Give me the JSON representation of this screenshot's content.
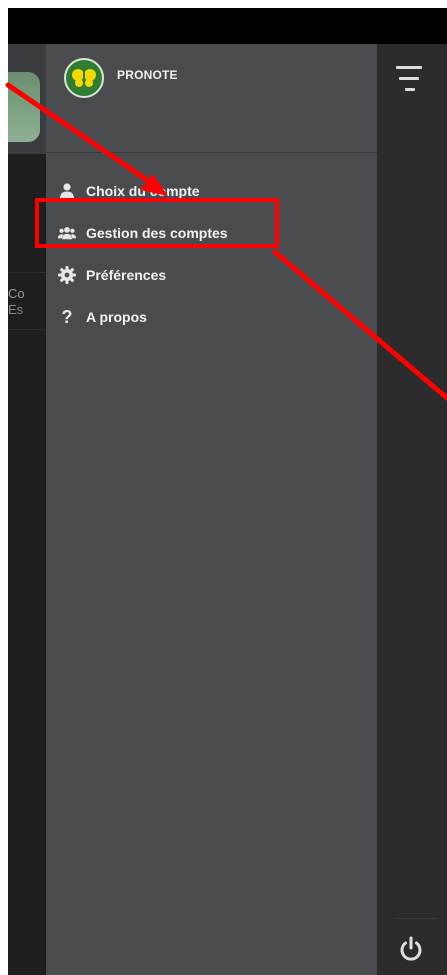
{
  "drawer": {
    "app_name": "PRONOTE",
    "menu": [
      {
        "label": "Choix du compte",
        "icon": "user-icon"
      },
      {
        "label": "Gestion des comptes",
        "icon": "users-icon"
      },
      {
        "label": "Préférences",
        "icon": "gear-icon"
      },
      {
        "label": "A propos",
        "icon": "question-icon"
      }
    ]
  },
  "background_app": {
    "row_line1": "Co",
    "row_line2": "Es"
  },
  "colors": {
    "drawer_bg": "#4a4b4f",
    "annotation": "#ff0000",
    "logo_green": "#2e7d32",
    "butterfly_yellow": "#f5d800"
  },
  "icons": {
    "menu": "hamburger-menu-icon",
    "power": "power-icon",
    "logo": "butterfly-logo-icon"
  }
}
